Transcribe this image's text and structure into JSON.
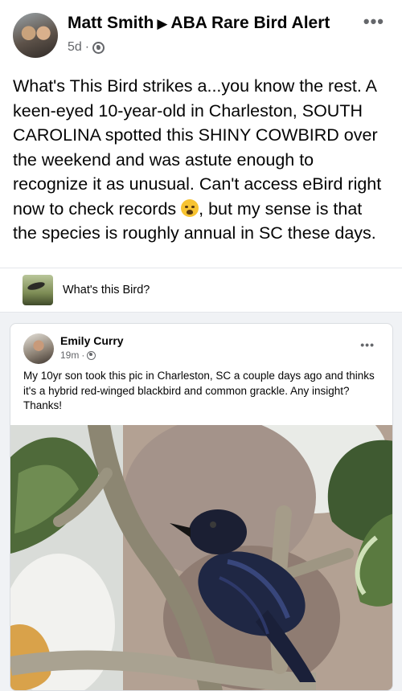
{
  "post": {
    "author": "Matt Smith",
    "arrow": "▶",
    "group": "ABA Rare Bird Alert",
    "time": "5d",
    "separator": "·",
    "more": "•••",
    "text_part1": "What's This Bird strikes a...you know the rest. A keen-eyed 10-year-old in Charleston, SOUTH CAROLINA spotted this SHINY COWBIRD over the weekend and was astute enough to recognize it as unusual. Can't access eBird right now to check records ",
    "emoji": "crying-face",
    "text_part2": ", but my sense is that the species is roughly annual in SC these days."
  },
  "shared_group": {
    "name": "What's this Bird?"
  },
  "shared_post": {
    "author": "Emily Curry",
    "time": "19m",
    "separator": "·",
    "more": "•••",
    "text": "My 10yr son took this pic in Charleston, SC a couple days ago and thinks it's a hybrid red-winged blackbird and common grackle. Any insight? Thanks!"
  },
  "icons": {
    "privacy": "globe-icon",
    "menu": "more-options-icon"
  },
  "colors": {
    "secondary_text": "#65676b",
    "divider": "#e4e6eb",
    "feed_background": "#f0f2f5"
  }
}
